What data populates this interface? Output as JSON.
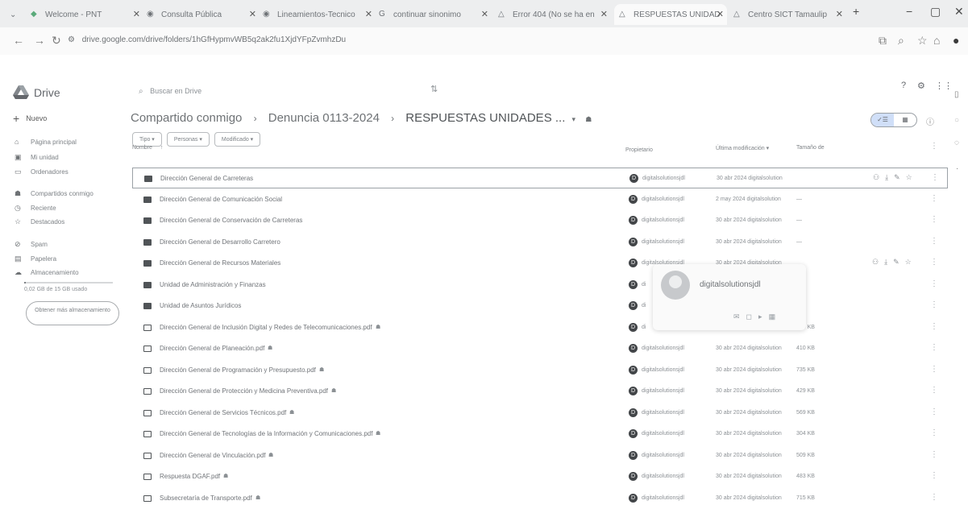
{
  "browser": {
    "tabs": [
      {
        "title": "Welcome - PNT"
      },
      {
        "title": "Consulta Pública"
      },
      {
        "title": "Lineamientos-Tecnico"
      },
      {
        "title": "continuar sinonimo"
      },
      {
        "title": "Error 404 (No se ha en"
      },
      {
        "title": "RESPUESTAS UNIDAD"
      },
      {
        "title": "Centro SICT Tamaulip"
      }
    ],
    "url": "drive.google.com/drive/folders/1hGfHypmvWB5q2ak2fu1XjdYFpZvmhzDu"
  },
  "drive": {
    "logo": "Drive",
    "search_placeholder": "Buscar en Drive",
    "new_label": "Nuevo",
    "sidebar": [
      {
        "label": "Página principal",
        "icon": "home-icon"
      },
      {
        "label": "Mi unidad",
        "icon": "drive-icon"
      },
      {
        "label": "Ordenadores",
        "icon": "computer-icon"
      },
      {
        "label": "Compartidos conmigo",
        "icon": "people-icon"
      },
      {
        "label": "Reciente",
        "icon": "clock-icon"
      },
      {
        "label": "Destacados",
        "icon": "star-icon"
      },
      {
        "label": "Spam",
        "icon": "spam-icon"
      },
      {
        "label": "Papelera",
        "icon": "trash-icon"
      },
      {
        "label": "Almacenamiento",
        "icon": "cloud-icon"
      }
    ],
    "storage": {
      "text": "0,02 GB de 15 GB usado",
      "used_fraction": 0.02
    },
    "storage_button": "Obtener más almacenamiento",
    "breadcrumb": [
      "Compartido conmigo",
      "Denuncia 0113-2024",
      "RESPUESTAS UNIDADES ..."
    ],
    "filters": [
      "Tipo",
      "Personas",
      "Modificado"
    ],
    "columns": {
      "name": "Nombre",
      "owner": "Propietario",
      "modified": "Última modificación",
      "size": "Tamaño de"
    },
    "hover_card": {
      "name": "digitalsolutionsjdl"
    },
    "rows": [
      {
        "name": "Dirección General de Carreteras",
        "type": "folder",
        "owner": "digitalsolutionsjdl",
        "modified": "30 abr 2024 digitalsolution",
        "size": ""
      },
      {
        "name": "Dirección General de Comunicación Social",
        "type": "folder",
        "owner": "digitalsolutionsjdl",
        "modified": "2 may 2024 digitalsolution",
        "size": "—"
      },
      {
        "name": "Dirección General de Conservación de Carreteras",
        "type": "folder",
        "owner": "digitalsolutionsjdl",
        "modified": "30 abr 2024 digitalsolution",
        "size": "—"
      },
      {
        "name": "Dirección General de Desarrollo Carretero",
        "type": "folder",
        "owner": "digitalsolutionsjdl",
        "modified": "30 abr 2024 digitalsolution",
        "size": "—"
      },
      {
        "name": "Dirección General de Recursos Materiales",
        "type": "folder",
        "owner": "digitalsolutionsjdl",
        "modified": "30 abr 2024 digitalsolution",
        "size": ""
      },
      {
        "name": "Unidad de Administración y Finanzas",
        "type": "folder",
        "owner": "di",
        "modified": "",
        "size": ""
      },
      {
        "name": "Unidad de Asuntos Jurídicos",
        "type": "folder",
        "owner": "di",
        "modified": "",
        "size": ""
      },
      {
        "name": "Dirección General de Inclusión Digital y Redes de Telecomunicaciones.pdf",
        "type": "pdf",
        "owner": "di",
        "modified": "",
        "size": "180 KB"
      },
      {
        "name": "Dirección General de Planeación.pdf",
        "type": "pdf",
        "owner": "digitalsolutionsjdl",
        "modified": "30 abr 2024 digitalsolution",
        "size": "410 KB"
      },
      {
        "name": "Dirección General de Programación y Presupuesto.pdf",
        "type": "pdf",
        "owner": "digitalsolutionsjdl",
        "modified": "30 abr 2024 digitalsolution",
        "size": "735 KB"
      },
      {
        "name": "Dirección General de Protección y Medicina Preventiva.pdf",
        "type": "pdf",
        "owner": "digitalsolutionsjdl",
        "modified": "30 abr 2024 digitalsolution",
        "size": "429 KB"
      },
      {
        "name": "Dirección General de Servicios Técnicos.pdf",
        "type": "pdf",
        "owner": "digitalsolutionsjdl",
        "modified": "30 abr 2024 digitalsolution",
        "size": "569 KB"
      },
      {
        "name": "Dirección General de Tecnologías de la Información y Comunicaciones.pdf",
        "type": "pdf",
        "owner": "digitalsolutionsjdl",
        "modified": "30 abr 2024 digitalsolution",
        "size": "304 KB"
      },
      {
        "name": "Dirección General de Vinculación.pdf",
        "type": "pdf",
        "owner": "digitalsolutionsjdl",
        "modified": "30 abr 2024 digitalsolution",
        "size": "509 KB"
      },
      {
        "name": "Respuesta DGAF.pdf",
        "type": "pdf",
        "owner": "digitalsolutionsjdl",
        "modified": "30 abr 2024 digitalsolution",
        "size": "483 KB"
      },
      {
        "name": "Subsecretaría de Transporte.pdf",
        "type": "pdf",
        "owner": "digitalsolutionsjdl",
        "modified": "30 abr 2024 digitalsolution",
        "size": "715 KB"
      }
    ]
  }
}
